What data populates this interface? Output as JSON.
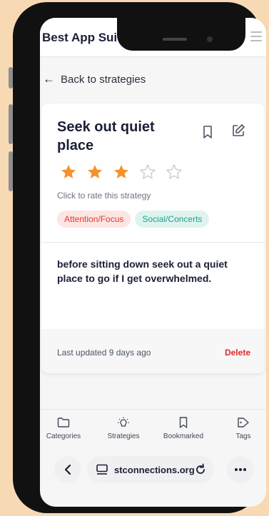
{
  "app": {
    "title": "Best App Suite"
  },
  "nav": {
    "back_label": "Back to strategies"
  },
  "strategy": {
    "title": "Seek out quiet place",
    "rating": 3,
    "max_rating": 5,
    "rate_hint": "Click to rate this strategy",
    "tags": [
      {
        "label": "Attention/Focus",
        "color": "#e03a2f",
        "bg": "#fde5e3"
      },
      {
        "label": "Social/Concerts",
        "color": "#1f9f84",
        "bg": "#dff4f0"
      }
    ],
    "description": "before sitting down seek out a quiet place to go if I get overwhelmed.",
    "last_updated": "Last updated 9 days ago",
    "delete_label": "Delete"
  },
  "bottom_nav": [
    {
      "label": "Categories",
      "icon": "folder-icon"
    },
    {
      "label": "Strategies",
      "icon": "lightbulb-icon"
    },
    {
      "label": "Bookmarked",
      "icon": "bookmark-icon"
    },
    {
      "label": "Tags",
      "icon": "tag-icon"
    }
  ],
  "browser": {
    "url": "stconnections.org"
  },
  "colors": {
    "star_filled": "#f5922f",
    "star_empty": "#c9ccd2",
    "delete": "#e0292b"
  }
}
